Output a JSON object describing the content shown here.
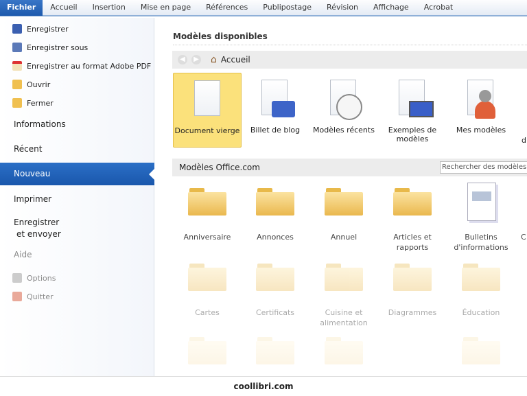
{
  "tabs": [
    "Fichier",
    "Accueil",
    "Insertion",
    "Mise en page",
    "Références",
    "Publipostage",
    "Révision",
    "Affichage",
    "Acrobat"
  ],
  "sidebar": {
    "commands": [
      "Enregistrer",
      "Enregistrer sous",
      "Enregistrer au format Adobe PDF",
      "Ouvrir",
      "Fermer"
    ],
    "informations": "Informations",
    "recent": "Récent",
    "nouveau": "Nouveau",
    "imprimer": "Imprimer",
    "enregistrer_envoyer_1": "Enregistrer",
    "enregistrer_envoyer_2": "et envoyer",
    "aide": "Aide",
    "options": "Options",
    "quitter": "Quitter"
  },
  "main": {
    "title": "Modèles disponibles",
    "breadcrumb": "Accueil",
    "templates": [
      "Document vierge",
      "Billet de blog",
      "Modèles récents",
      "Exemples de modèles",
      "Mes modèles",
      "d"
    ],
    "office_section": "Modèles Office.com",
    "search_placeholder": "Rechercher des modèles su",
    "folders_row1": [
      "Anniversaire",
      "Annonces",
      "Annuel",
      "Articles et rapports",
      "Bulletins d'informations",
      "C"
    ],
    "folders_row2": [
      "Cartes",
      "Certificats",
      "Cuisine et alimentation",
      "Diagrammes",
      "Éducation"
    ]
  },
  "footer": "coollibri.com"
}
